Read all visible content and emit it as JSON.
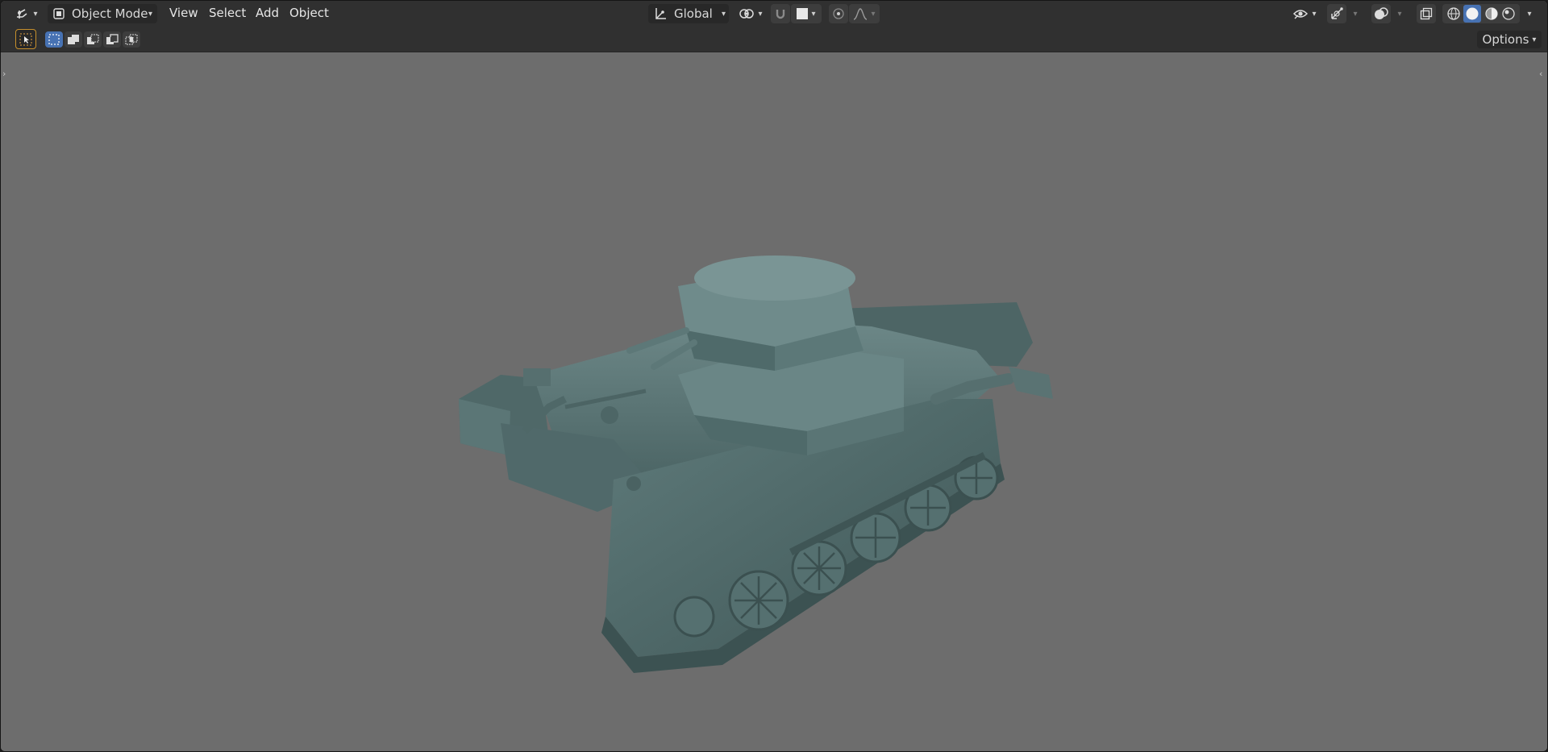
{
  "header": {
    "editor_type_icon": "viewport-3d-icon",
    "mode": "Object Mode",
    "menus": [
      "View",
      "Select",
      "Add",
      "Object"
    ],
    "transform_orientation": "Global",
    "pivot_icon": "transform-pivot-icon",
    "snap_icon": "magnet-icon",
    "proportional_icon": "proportional-edit-icon",
    "falloff_icon": "falloff-curve-icon",
    "visibility_icon": "eye-icon",
    "gizmo_icon": "gizmo-icon",
    "overlay_icon": "overlay-icon",
    "xray_icon": "xray-icon",
    "shading_modes": [
      "wireframe",
      "solid",
      "material-preview",
      "rendered"
    ],
    "active_shading": "solid"
  },
  "tool_header": {
    "active_tool_icon": "select-box-icon",
    "select_modes": [
      "new-selection",
      "extend-selection",
      "subtract-selection",
      "invert-selection",
      "intersect-selection"
    ],
    "options_label": "Options"
  },
  "viewport": {
    "background_color": "#6d6d6d",
    "object": "tank-model",
    "object_color": "#5a7575"
  }
}
